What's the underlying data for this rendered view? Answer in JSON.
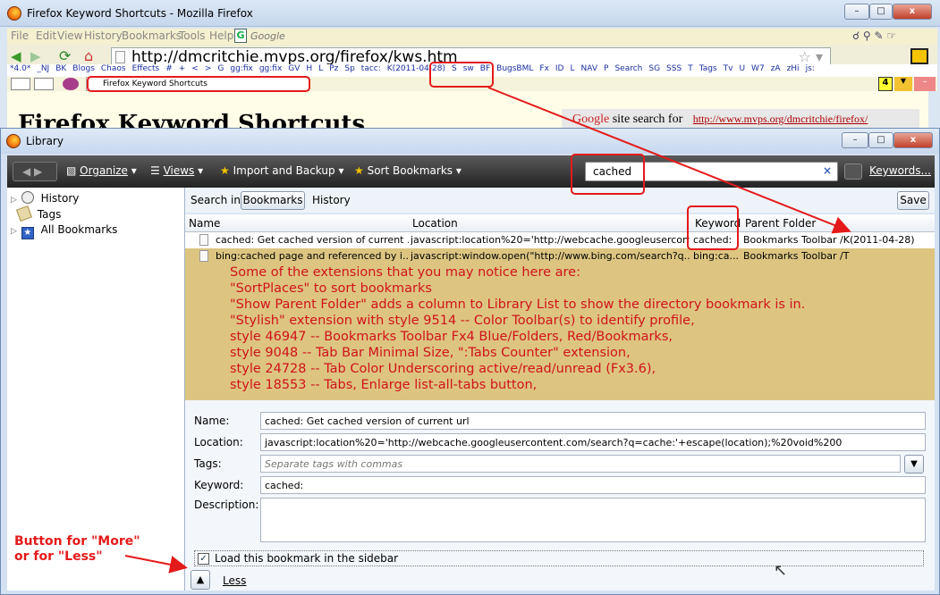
{
  "firefox": {
    "title": "Firefox Keyword Shortcuts - Mozilla Firefox",
    "menu": [
      "File",
      "Edit",
      "View",
      "History",
      "Bookmarks",
      "Tools",
      "Help"
    ],
    "search_placeholder": "Google",
    "url": "http://dmcritchie.mvps.org/firefox/kws.htm",
    "bookmarks_bar": [
      "*4.0*",
      "_NJ",
      "BK",
      "Blogs",
      "Chaos",
      "Effects",
      "#",
      "+",
      "<",
      ">",
      "G",
      "gg:fix",
      "gg:fix",
      "GV",
      "H",
      "L",
      "Pz",
      "Sp",
      "tacc:",
      "K(2011-04-28)",
      "S",
      "sw",
      "BF",
      "BugsBML",
      "Fx",
      "ID",
      "L",
      "NAV",
      "P",
      "Search",
      "SG",
      "SSS",
      "T",
      "Tags",
      "Tv",
      "U",
      "W7",
      "zA",
      "zHi",
      "js:"
    ],
    "tab_label": "Firefox Keyword Shortcuts",
    "tab_count": "4",
    "page_heading": "Firefox Keyword Shortcuts",
    "site_search_brand": "Google",
    "site_search_text": "site search for",
    "site_search_url": "http://www.mvps.org/dmcritchie/firefox/"
  },
  "library": {
    "title": "Library",
    "toolbar": {
      "organize": "Organize",
      "views": "Views",
      "import_backup": "Import and Backup",
      "sort": "Sort Bookmarks",
      "search_value": "cached",
      "keywords": "Keywords..."
    },
    "tree": [
      "History",
      "Tags",
      "All Bookmarks"
    ],
    "scope": {
      "label": "Search in:",
      "bookmarks": "Bookmarks",
      "history": "History",
      "save": "Save"
    },
    "columns": [
      "Name",
      "Location",
      "Keyword",
      "Parent Folder"
    ],
    "rows": [
      {
        "name": "cached:  Get cached version of current ...",
        "location": "javascript:location%20='http://webcache.googleusercont...",
        "keyword": "cached:",
        "parent": "Bookmarks Toolbar /K(2011-04-28)"
      },
      {
        "name": "bing:cached   page and referenced by i...",
        "location": "javascript:window.open(\"http://www.bing.com/search?q...",
        "keyword": "bing:ca...",
        "parent": "Bookmarks Toolbar /T"
      }
    ],
    "annotation": [
      "Some of the extensions that you may notice here are:",
      "\"SortPlaces\" to sort bookmarks",
      "\"Show Parent Folder\" adds a column to Library List to show the directory bookmark is in.",
      "\"Stylish\" extension with style 9514 -- Color Toolbar(s) to identify profile,",
      "style 46947 -- Bookmarks Toolbar Fx4 Blue/Folders, Red/Bookmarks,",
      "style 9048   -- Tab Bar Minimal Size, \":Tabs Counter\" extension,",
      "style 24728 -- Tab Color Underscoring active/read/unread (Fx3.6),",
      "style 18553 -- Tabs, Enlarge list-all-tabs button,"
    ],
    "details": {
      "name_label": "Name:",
      "name_value": "cached:  Get cached version of current url",
      "location_label": "Location:",
      "location_value": "javascript:location%20='http://webcache.googleusercontent.com/search?q=cache:'+escape(location);%20void%200",
      "tags_label": "Tags:",
      "tags_placeholder": "Separate tags with commas",
      "keyword_label": "Keyword:",
      "keyword_value": "cached:",
      "description_label": "Description:",
      "sidebar_checkbox": "Load this bookmark in the sidebar",
      "less_label": "Less"
    },
    "callout": [
      "Button for \"More\"",
      "or for \"Less\""
    ]
  }
}
